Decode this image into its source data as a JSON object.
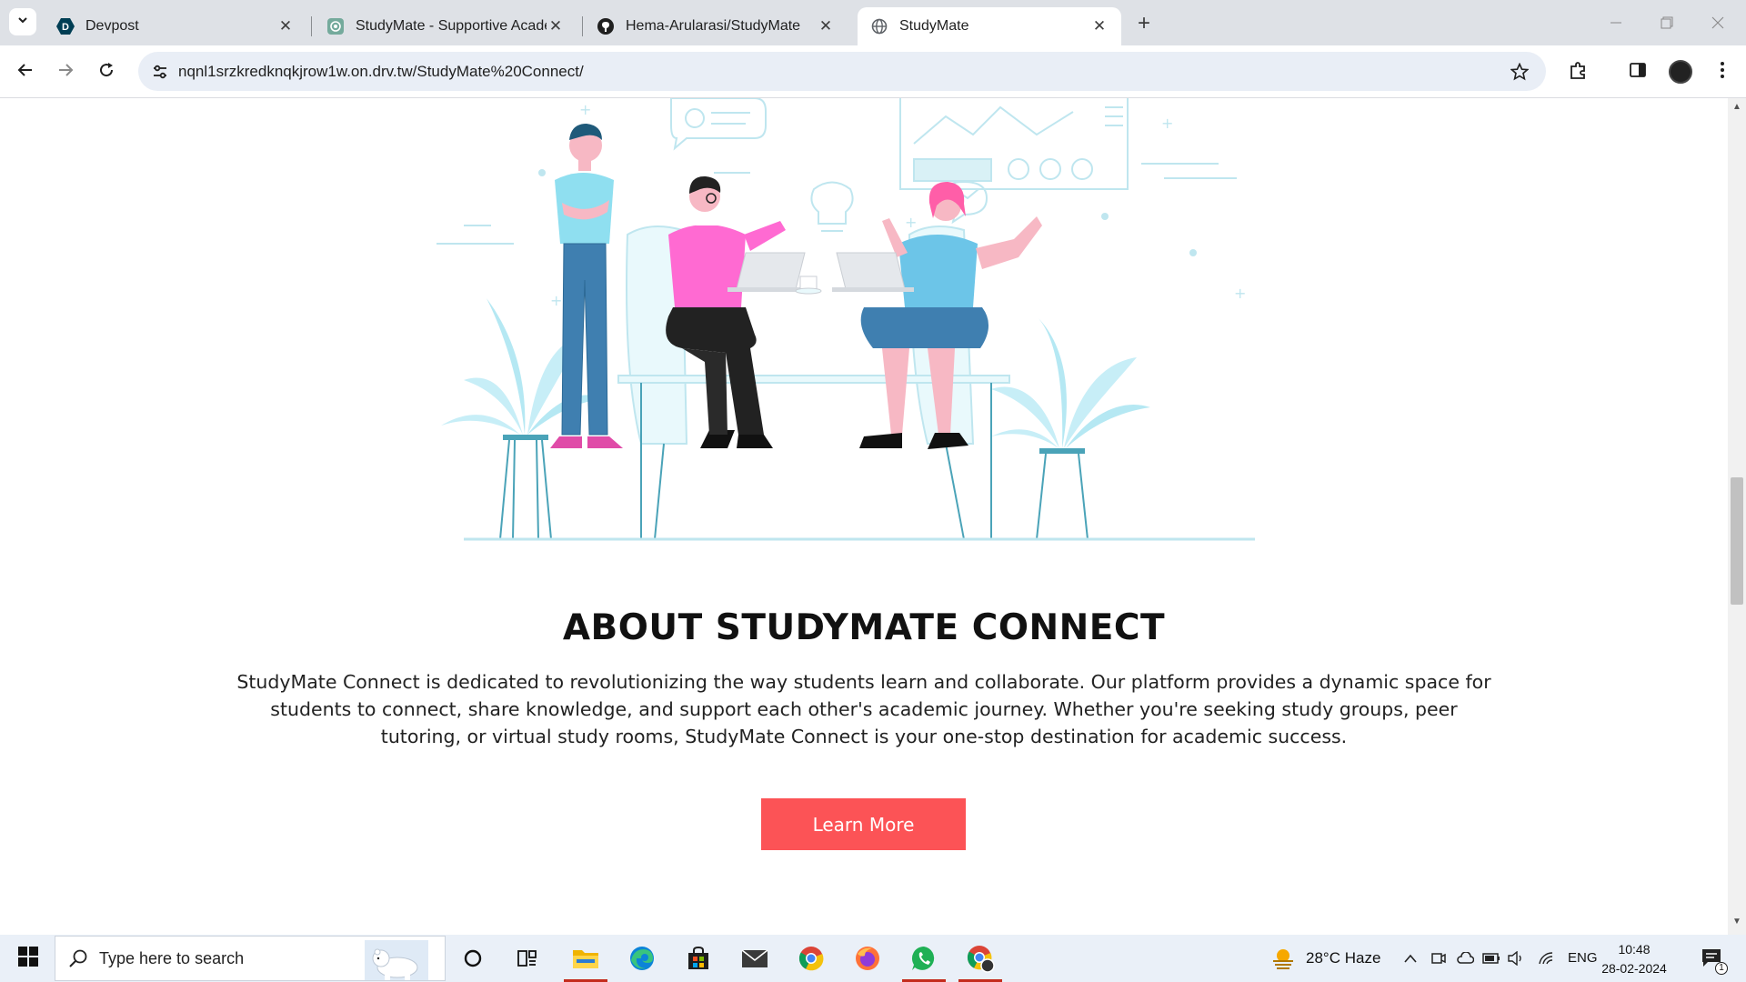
{
  "browser": {
    "tabs": [
      {
        "title": "Devpost",
        "icon": "devpost-icon",
        "active": false
      },
      {
        "title": "StudyMate - Supportive Academ",
        "icon": "openai-icon",
        "active": false
      },
      {
        "title": "Hema-Arularasi/StudyMate",
        "icon": "github-icon",
        "active": false
      },
      {
        "title": "StudyMate",
        "icon": "globe-icon",
        "active": true
      }
    ],
    "url": "nqnl1srzkredknqkjrow1w.on.drv.tw/StudyMate%20Connect/"
  },
  "page": {
    "about_title": "ABOUT STUDYMATE CONNECT",
    "about_text": "StudyMate Connect is dedicated to revolutionizing the way students learn and collaborate. Our platform provides a dynamic space for students to connect, share knowledge, and support each other's academic journey. Whether you're seeking study groups, peer tutoring, or virtual study rooms, StudyMate Connect is your one-stop destination for academic success.",
    "learn_more": "Learn More",
    "accent_color": "#fc5356"
  },
  "taskbar": {
    "search_placeholder": "Type here to search",
    "apps": [
      "cortana-icon",
      "task-view-icon",
      "file-explorer-icon",
      "edge-icon",
      "store-icon",
      "mail-icon",
      "chrome-icon",
      "firefox-icon",
      "whatsapp-icon",
      "chrome-profile-icon"
    ],
    "weather": "28°C  Haze",
    "language": "ENG",
    "time": "10:48",
    "date": "28-02-2024",
    "notification_count": "1"
  }
}
